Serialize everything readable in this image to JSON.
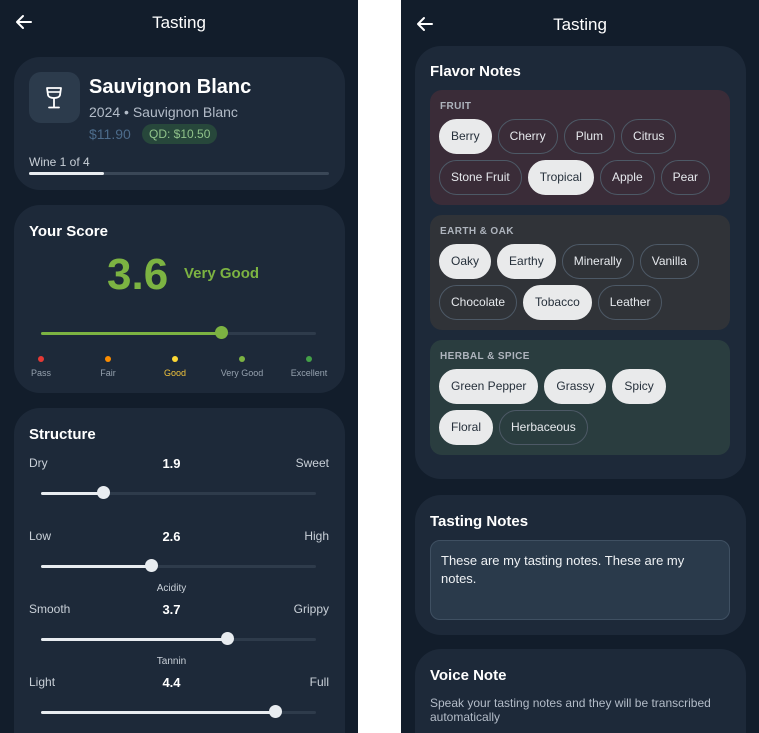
{
  "left_screen": {
    "header": {
      "title": "Tasting",
      "back_icon": "arrow-left-icon"
    },
    "wine": {
      "icon": "wine-glass-icon",
      "name": "Sauvignon Blanc",
      "subtitle": "2024 • Sauvignon Blanc",
      "price": "$11.90",
      "qd_price": "QD: $10.50",
      "progress_label": "Wine 1 of 4",
      "progress": 0.25
    },
    "score": {
      "title": "Your Score",
      "value": "3.6",
      "label": "Very Good",
      "fraction": 0.655,
      "steps": [
        {
          "label": "Pass",
          "color": "#e53935"
        },
        {
          "label": "Fair",
          "color": "#fb8c00"
        },
        {
          "label": "Good",
          "color": "#fdd835"
        },
        {
          "label": "Very Good",
          "color": "#7cb342"
        },
        {
          "label": "Excellent",
          "color": "#43a047"
        }
      ]
    },
    "structure": {
      "title": "Structure",
      "rows": [
        {
          "left": "Dry",
          "right": "Sweet",
          "value": "1.9",
          "name": "",
          "fraction": 0.225
        },
        {
          "left": "Low",
          "right": "High",
          "value": "2.6",
          "name": "Acidity",
          "fraction": 0.4
        },
        {
          "left": "Smooth",
          "right": "Grippy",
          "value": "3.7",
          "name": "Tannin",
          "fraction": 0.675
        },
        {
          "left": "Light",
          "right": "Full",
          "value": "4.4",
          "name": "",
          "fraction": 0.85
        }
      ]
    }
  },
  "right_screen": {
    "header": {
      "title": "Tasting",
      "back_icon": "arrow-left-icon"
    },
    "flavor": {
      "title": "Flavor Notes",
      "groups": [
        {
          "title": "FRUIT",
          "bg": "#3a2c38",
          "chips": [
            {
              "label": "Berry",
              "selected": true
            },
            {
              "label": "Cherry",
              "selected": false
            },
            {
              "label": "Plum",
              "selected": false
            },
            {
              "label": "Citrus",
              "selected": false
            },
            {
              "label": "Stone Fruit",
              "selected": false
            },
            {
              "label": "Tropical",
              "selected": true
            },
            {
              "label": "Apple",
              "selected": false
            },
            {
              "label": "Pear",
              "selected": false
            }
          ]
        },
        {
          "title": "EARTH & OAK",
          "bg": "#303338",
          "chips": [
            {
              "label": "Oaky",
              "selected": true
            },
            {
              "label": "Earthy",
              "selected": true
            },
            {
              "label": "Minerally",
              "selected": false
            },
            {
              "label": "Vanilla",
              "selected": false
            },
            {
              "label": "Chocolate",
              "selected": false
            },
            {
              "label": "Tobacco",
              "selected": true
            },
            {
              "label": "Leather",
              "selected": false
            }
          ]
        },
        {
          "title": "HERBAL & SPICE",
          "bg": "#2a3d3f",
          "chips": [
            {
              "label": "Green Pepper",
              "selected": true
            },
            {
              "label": "Grassy",
              "selected": true
            },
            {
              "label": "Spicy",
              "selected": true
            },
            {
              "label": "Floral",
              "selected": true
            },
            {
              "label": "Herbaceous",
              "selected": false
            }
          ]
        }
      ]
    },
    "tasting_notes": {
      "title": "Tasting Notes",
      "text": "These are my tasting notes. These are my notes."
    },
    "voice_note": {
      "title": "Voice Note",
      "description": "Speak your tasting notes and they will be transcribed automatically"
    }
  },
  "colors": {
    "background": "#121d2b",
    "card": "#1d2939",
    "accent_green": "#7cb342",
    "selected_chip": "#e9eaeb"
  }
}
